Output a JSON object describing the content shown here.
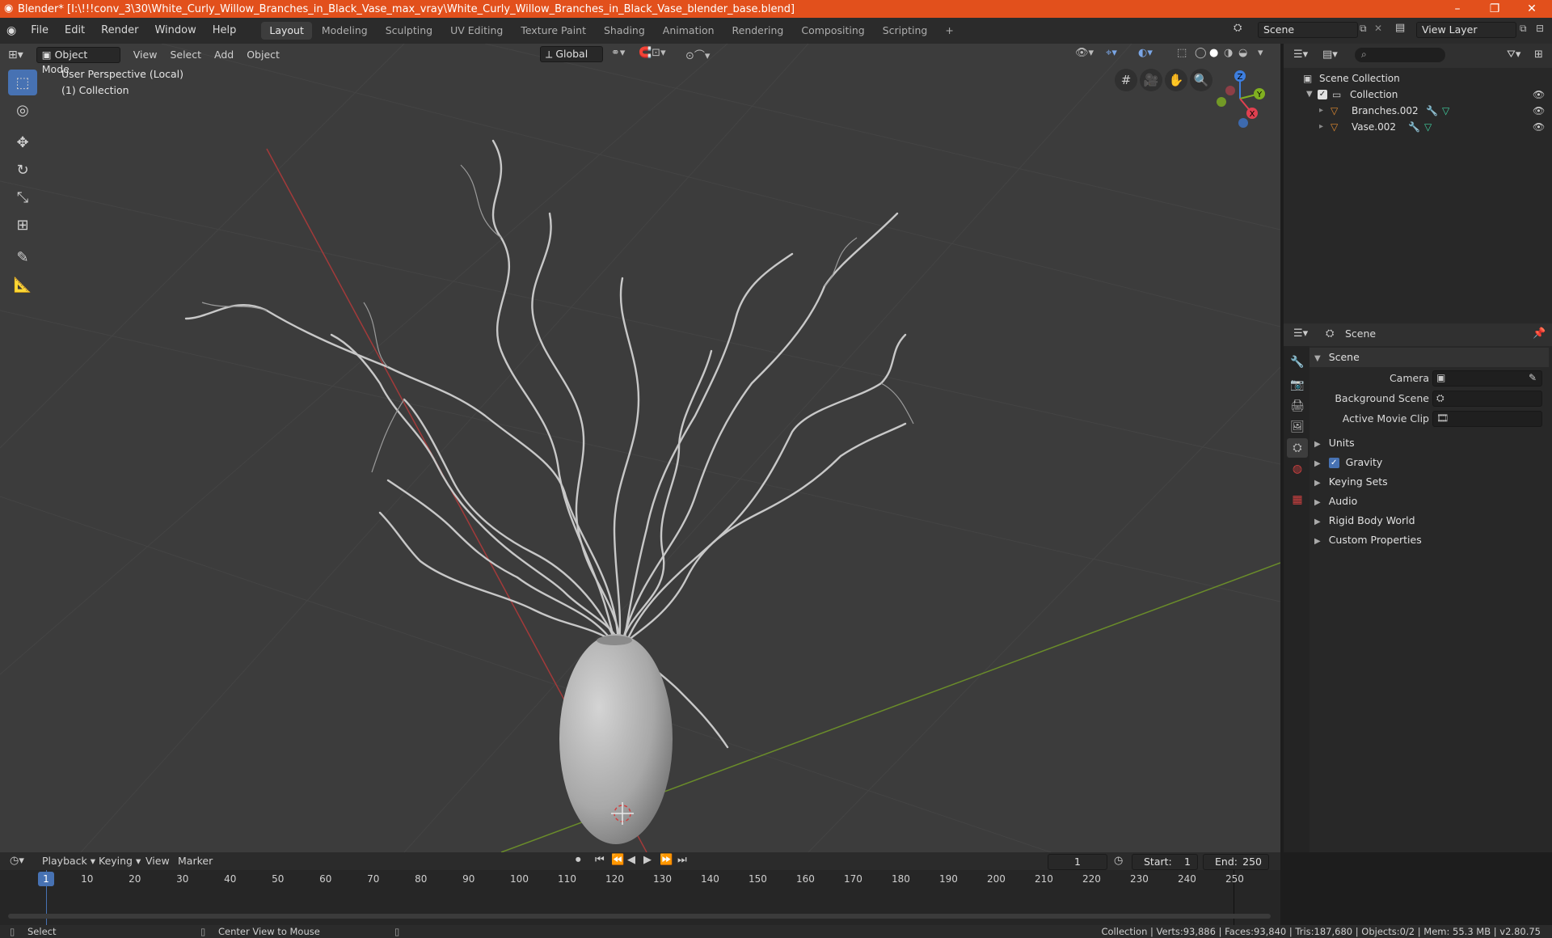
{
  "window": {
    "title": "Blender* [I:\\!!!conv_3\\30\\White_Curly_Willow_Branches_in_Black_Vase_max_vray\\White_Curly_Willow_Branches_in_Black_Vase_blender_base.blend]",
    "minimize": "–",
    "maximize": "❐",
    "close": "✕"
  },
  "menu": [
    "File",
    "Edit",
    "Render",
    "Window",
    "Help"
  ],
  "workspaces": [
    "Layout",
    "Modeling",
    "Sculpting",
    "UV Editing",
    "Texture Paint",
    "Shading",
    "Animation",
    "Rendering",
    "Compositing",
    "Scripting"
  ],
  "add_workspace": "+",
  "scene_selector": {
    "label": "Scene"
  },
  "view_layer_selector": {
    "label": "View Layer"
  },
  "viewport": {
    "mode": "Object Mode",
    "menus": [
      "View",
      "Select",
      "Add",
      "Object"
    ],
    "orientation": "Global",
    "info_line1": "User Perspective (Local)",
    "info_line2": "(1) Collection",
    "gizmo": {
      "x": "X",
      "y": "Y",
      "z": "Z"
    }
  },
  "outliner": {
    "root": "Scene Collection",
    "collection": "Collection",
    "items": [
      "Branches.002",
      "Vase.002"
    ]
  },
  "properties": {
    "context": "Scene",
    "panel": "Scene",
    "fields": {
      "camera": "Camera",
      "background_scene": "Background Scene",
      "active_movie_clip": "Active Movie Clip"
    },
    "panels": [
      "Units",
      "Gravity",
      "Keying Sets",
      "Audio",
      "Rigid Body World",
      "Custom Properties"
    ],
    "gravity_checked": true
  },
  "timeline": {
    "menus": [
      "Playback",
      "Keying",
      "View",
      "Marker"
    ],
    "current_frame": "1",
    "start_label": "Start:",
    "start": "1",
    "end_label": "End:",
    "end": "250",
    "ticks": [
      "1",
      "10",
      "20",
      "30",
      "40",
      "50",
      "60",
      "70",
      "80",
      "90",
      "100",
      "110",
      "120",
      "130",
      "140",
      "150",
      "160",
      "170",
      "180",
      "190",
      "200",
      "210",
      "220",
      "230",
      "240",
      "250"
    ]
  },
  "statusbar": {
    "select": "Select",
    "center": "Center View to Mouse",
    "stats": "Collection | Verts:93,886 | Faces:93,840 | Tris:187,680 | Objects:0/2 | Mem: 55.3 MB | v2.80.75"
  }
}
